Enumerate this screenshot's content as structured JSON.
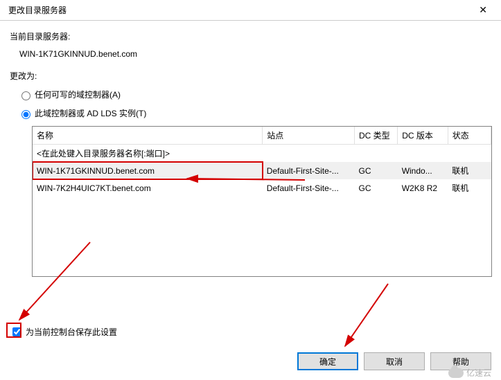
{
  "title": "更改目录服务器",
  "current_label": "当前目录服务器:",
  "current_server": "WIN-1K71GKINNUD.benet.com",
  "change_to_label": "更改为:",
  "radio_any": "任何可写的域控制器(A)",
  "radio_this": "此域控制器或 AD LDS 实例(T)",
  "headers": {
    "name": "名称",
    "site": "站点",
    "dctype": "DC 类型",
    "dcver": "DC 版本",
    "status": "状态"
  },
  "input_placeholder": "<在此处键入目录服务器名称[:端口]>",
  "rows": [
    {
      "name": "WIN-1K71GKINNUD.benet.com",
      "site": "Default-First-Site-...",
      "dctype": "GC",
      "dcver": "Windo...",
      "status": "联机",
      "selected": true
    },
    {
      "name": "WIN-7K2H4UIC7KT.benet.com",
      "site": "Default-First-Site-...",
      "dctype": "GC",
      "dcver": "W2K8 R2",
      "status": "联机",
      "selected": false
    }
  ],
  "save_checkbox": "为当前控制台保存此设置",
  "buttons": {
    "ok": "确定",
    "cancel": "取消",
    "help": "帮助"
  },
  "watermark": "亿速云"
}
